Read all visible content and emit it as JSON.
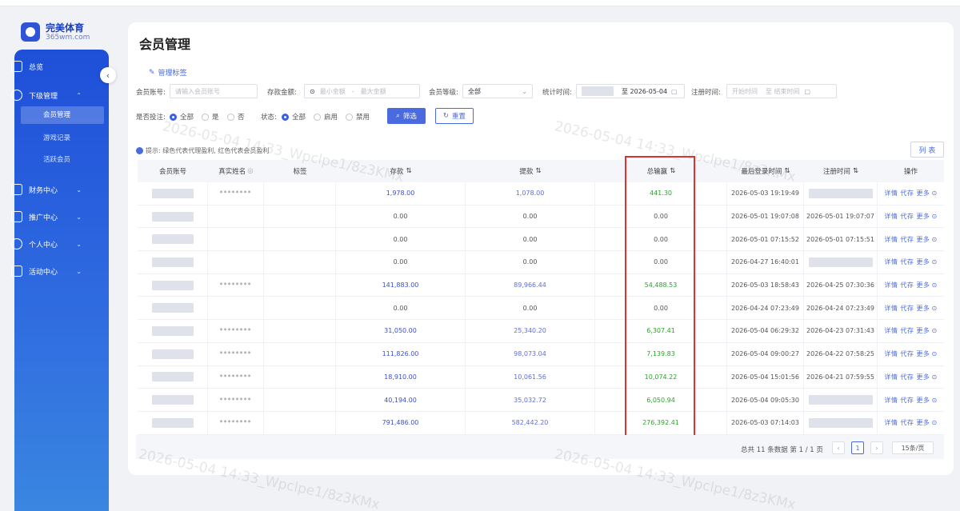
{
  "brand": {
    "name": "完美体育",
    "domain": "365wm.com"
  },
  "sidebar": {
    "items": [
      {
        "label": "总览",
        "icon": "monitor-icon"
      },
      {
        "label": "下级管理",
        "icon": "org-icon",
        "expanded": true,
        "children": [
          "会员管理",
          "游戏记录",
          "活跃会员"
        ]
      },
      {
        "label": "财务中心",
        "icon": "finance-icon"
      },
      {
        "label": "推广中心",
        "icon": "promo-icon"
      },
      {
        "label": "个人中心",
        "icon": "user-icon"
      },
      {
        "label": "活动中心",
        "icon": "gift-icon"
      }
    ]
  },
  "page": {
    "title": "会员管理",
    "manage_tags": "管理标签"
  },
  "filters": {
    "account_label": "会员账号:",
    "account_placeholder": "请输入会员账号",
    "deposit_label": "存款金额:",
    "deposit_min": "最小金额",
    "deposit_max": "最大金额",
    "level_label": "会员等级:",
    "level_value": "全部",
    "stat_label": "统计时间:",
    "stat_to": "至 2026-05-04",
    "reg_label": "注册时间:",
    "reg_start": "开始时间",
    "reg_end": "至 结束时间",
    "bet_label": "是否投注:",
    "bet_all": "全部",
    "bet_yes": "是",
    "bet_no": "否",
    "status_label": "状态:",
    "status_all": "全部",
    "status_enabled": "启用",
    "status_disabled": "禁用",
    "filter_button": "筛选",
    "reset_button": "重置"
  },
  "tip": "提示: 绿色代表代理盈利, 红色代表会员盈利",
  "columns_button": "列 表",
  "table": {
    "headers": [
      "会员账号",
      "真实姓名",
      "标签",
      "存款",
      "提款",
      "总输赢",
      "最后登录时间",
      "注册时间",
      "操作"
    ],
    "rows": [
      {
        "name": "********",
        "deposit": "1,978.00",
        "withdraw": "1,078.00",
        "winloss": "441.30",
        "last_login": "2026-05-03 19:19:49",
        "reg": ""
      },
      {
        "name": "",
        "deposit": "0.00",
        "withdraw": "0.00",
        "winloss": "0.00",
        "last_login": "2026-05-01 19:07:08",
        "reg": "2026-05-01 19:07:07"
      },
      {
        "name": "",
        "deposit": "0.00",
        "withdraw": "0.00",
        "winloss": "0.00",
        "last_login": "2026-05-01 07:15:52",
        "reg": "2026-05-01 07:15:51"
      },
      {
        "name": "",
        "deposit": "0.00",
        "withdraw": "0.00",
        "winloss": "0.00",
        "last_login": "2026-04-27 16:40:01",
        "reg": ""
      },
      {
        "name": "********",
        "deposit": "141,883.00",
        "withdraw": "89,966.44",
        "winloss": "54,488.53",
        "last_login": "2026-05-03 18:58:43",
        "reg": "2026-04-25 07:30:36"
      },
      {
        "name": "",
        "deposit": "0.00",
        "withdraw": "0.00",
        "winloss": "0.00",
        "last_login": "2026-04-24 07:23:49",
        "reg": "2026-04-24 07:23:49"
      },
      {
        "name": "********",
        "deposit": "31,050.00",
        "withdraw": "25,340.20",
        "winloss": "6,307.41",
        "last_login": "2026-05-04 06:29:32",
        "reg": "2026-04-23 07:31:43"
      },
      {
        "name": "********",
        "deposit": "111,826.00",
        "withdraw": "98,073.04",
        "winloss": "7,139.83",
        "last_login": "2026-05-04 09:00:27",
        "reg": "2026-04-22 07:58:25"
      },
      {
        "name": "********",
        "deposit": "18,910.00",
        "withdraw": "10,061.56",
        "winloss": "10,074.22",
        "last_login": "2026-05-04 15:01:56",
        "reg": "2026-04-21 07:59:55"
      },
      {
        "name": "********",
        "deposit": "40,194.00",
        "withdraw": "35,032.72",
        "winloss": "6,050.94",
        "last_login": "2026-05-04 09:05:30",
        "reg": ""
      },
      {
        "name": "********",
        "deposit": "791,486.00",
        "withdraw": "582,442.20",
        "winloss": "276,392.41",
        "last_login": "2026-05-03 07:14:03",
        "reg": ""
      }
    ],
    "ops": [
      "详情",
      "代存",
      "更多"
    ]
  },
  "pagination": {
    "summary": "总共 11 条数据 第 1 / 1 页",
    "current": "1",
    "page_size": "15条/页"
  },
  "watermark": "2026-05-04 14:33_Wpclpe1/8z3KMx"
}
